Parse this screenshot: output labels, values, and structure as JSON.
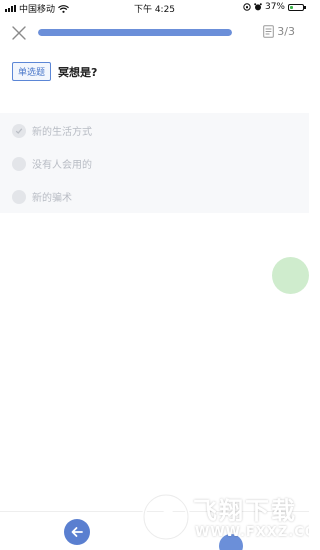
{
  "status_bar": {
    "carrier": "中国移动",
    "time": "下午 4:25",
    "battery_percent": "37%",
    "battery_level": 0.37
  },
  "header": {
    "progress": 1.0,
    "counter": "3/3"
  },
  "question": {
    "type_label": "单选题",
    "text": "冥想是?"
  },
  "options": [
    {
      "label": "新的生活方式",
      "checked": true
    },
    {
      "label": "没有人会用的",
      "checked": false
    },
    {
      "label": "新的骗术",
      "checked": false
    }
  ],
  "colors": {
    "accent": "#5a7fd0",
    "progress_fill": "#6b8fd9",
    "bubble": "#cfeccd"
  },
  "watermark": {
    "title": "飞翔下载",
    "url": "WWW.FXXZ.COM"
  }
}
